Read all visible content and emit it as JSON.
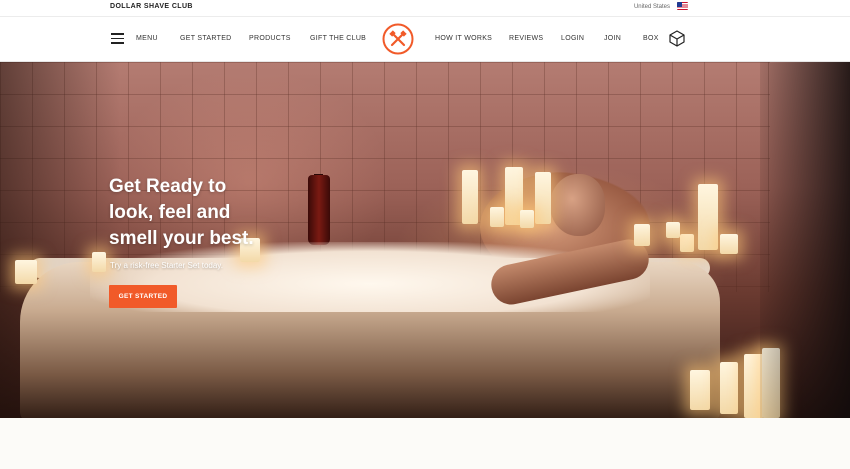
{
  "topbar": {
    "brand": "DOLLAR SHAVE CLUB",
    "country": "United States",
    "flag_icon": "us-flag-icon"
  },
  "nav": {
    "menu_label": "MENU",
    "left_items": [
      "GET STARTED",
      "PRODUCTS",
      "GIFT THE CLUB"
    ],
    "right_items": [
      "HOW IT WORKS",
      "REVIEWS",
      "LOGIN",
      "JOIN",
      "BOX"
    ],
    "logo_icon": "dsc-logo-icon",
    "box_icon": "box-icon"
  },
  "hero": {
    "title_lines": [
      "Get Ready to",
      "look, feel and",
      "smell your best."
    ],
    "subtitle": "Try a risk-free Starter Set today.",
    "cta_label": "GET STARTED"
  },
  "colors": {
    "accent": "#f15a29"
  }
}
